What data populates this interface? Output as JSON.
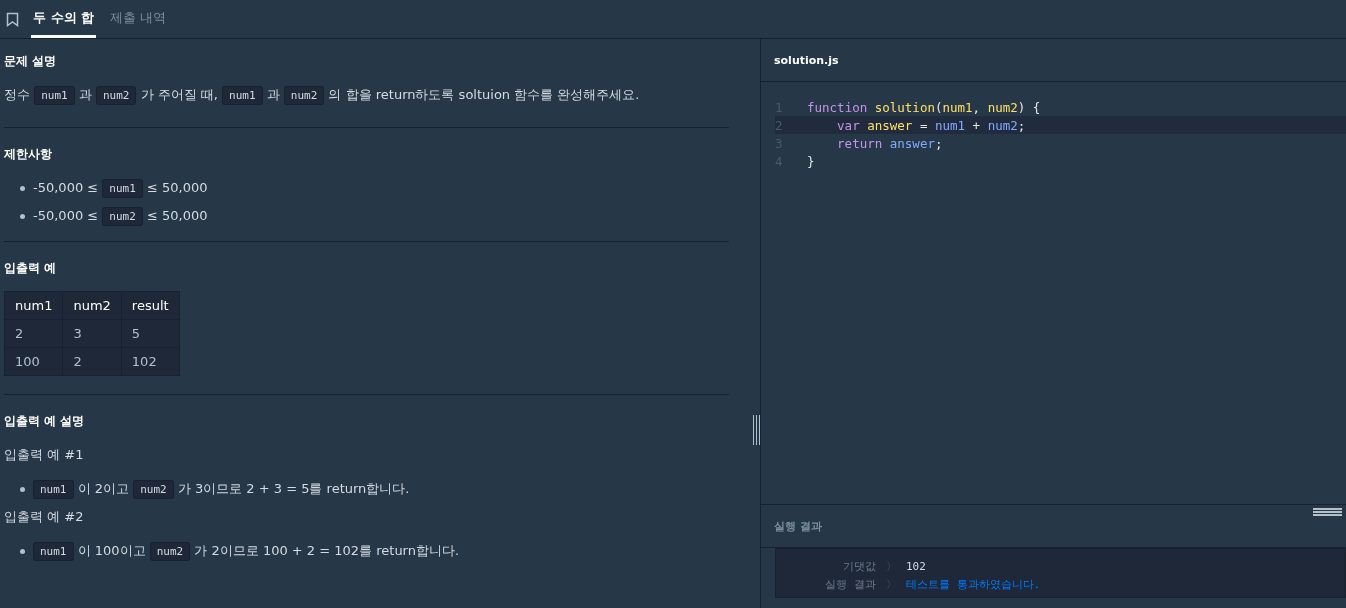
{
  "tabs": [
    {
      "label": "두 수의 합",
      "selected": true
    },
    {
      "label": "제출 내역",
      "selected": false
    }
  ],
  "problem": {
    "sections": [
      {
        "heading": "문제 설명",
        "blocks": [
          {
            "kind": "paragraph",
            "segments": [
              {
                "kind": "text",
                "text": "정수 "
              },
              {
                "kind": "code",
                "text": "num1"
              },
              {
                "kind": "text",
                "text": " 과 "
              },
              {
                "kind": "code",
                "text": "num2"
              },
              {
                "kind": "text",
                "text": " 가 주어질 때, "
              },
              {
                "kind": "code",
                "text": "num1"
              },
              {
                "kind": "text",
                "text": " 과 "
              },
              {
                "kind": "code",
                "text": "num2"
              },
              {
                "kind": "text",
                "text": " 의 합을 return하도록 soltuion 함수를 완성해주세요."
              }
            ]
          }
        ]
      },
      {
        "heading": "제한사항",
        "blocks": [
          {
            "kind": "bullet",
            "segments": [
              {
                "kind": "text",
                "text": "-50,000 ≤ "
              },
              {
                "kind": "code",
                "text": "num1"
              },
              {
                "kind": "text",
                "text": " ≤ 50,000"
              }
            ]
          },
          {
            "kind": "bullet",
            "segments": [
              {
                "kind": "text",
                "text": "-50,000 ≤ "
              },
              {
                "kind": "code",
                "text": "num2"
              },
              {
                "kind": "text",
                "text": " ≤ 50,000"
              }
            ]
          }
        ]
      },
      {
        "heading": "입출력 예",
        "blocks": [
          {
            "kind": "table",
            "columns": [
              "num1",
              "num2",
              "result"
            ],
            "rows": [
              [
                "2",
                "3",
                "5"
              ],
              [
                "100",
                "2",
                "102"
              ]
            ]
          }
        ]
      },
      {
        "heading": "입출력 예 설명",
        "blocks": [
          {
            "kind": "paragraph",
            "segments": [
              {
                "kind": "text",
                "text": "입출력 예 #1"
              }
            ]
          },
          {
            "kind": "bullet",
            "segments": [
              {
                "kind": "code",
                "text": "num1"
              },
              {
                "kind": "text",
                "text": " 이 2이고 "
              },
              {
                "kind": "code",
                "text": "num2"
              },
              {
                "kind": "text",
                "text": " 가 3이므로 2 + 3 = 5를 return합니다."
              }
            ]
          },
          {
            "kind": "paragraph",
            "segments": [
              {
                "kind": "text",
                "text": "입출력 예 #2"
              }
            ]
          },
          {
            "kind": "bullet",
            "segments": [
              {
                "kind": "code",
                "text": "num1"
              },
              {
                "kind": "text",
                "text": " 이 100이고 "
              },
              {
                "kind": "code",
                "text": "num2"
              },
              {
                "kind": "text",
                "text": " 가 2이므로 100 + 2 = 102를 return합니다."
              }
            ]
          }
        ]
      }
    ]
  },
  "editor": {
    "filename": "solution.js",
    "lines": [
      {
        "number": "1",
        "highlighted": false,
        "tokens": [
          {
            "kind": "keyword",
            "text": "function "
          },
          {
            "kind": "name",
            "text": "solution"
          },
          {
            "kind": "plain",
            "text": "("
          },
          {
            "kind": "name",
            "text": "num1"
          },
          {
            "kind": "plain",
            "text": ", "
          },
          {
            "kind": "name",
            "text": "num2"
          },
          {
            "kind": "plain",
            "text": ") {"
          }
        ]
      },
      {
        "number": "2",
        "highlighted": true,
        "indented": true,
        "tokens": [
          {
            "kind": "keyword",
            "text": "var "
          },
          {
            "kind": "name",
            "text": "answer"
          },
          {
            "kind": "plain",
            "text": " = "
          },
          {
            "kind": "variable",
            "text": "num1"
          },
          {
            "kind": "plain",
            "text": " + "
          },
          {
            "kind": "variable",
            "text": "num2"
          },
          {
            "kind": "plain",
            "text": ";"
          }
        ]
      },
      {
        "number": "3",
        "highlighted": false,
        "indented": true,
        "tokens": [
          {
            "kind": "keyword",
            "text": "return "
          },
          {
            "kind": "variable",
            "text": "answer"
          },
          {
            "kind": "plain",
            "text": ";"
          }
        ]
      },
      {
        "number": "4",
        "highlighted": false,
        "tokens": [
          {
            "kind": "plain",
            "text": "}"
          }
        ]
      }
    ]
  },
  "results": {
    "title": "실행 결과",
    "rows": [
      {
        "label": "기댓값",
        "separator": "〉",
        "value": "102",
        "kind": "value"
      },
      {
        "label": "실행 결과",
        "separator": "〉",
        "value": "테스트를 통과하였습니다.",
        "kind": "pass"
      }
    ]
  }
}
